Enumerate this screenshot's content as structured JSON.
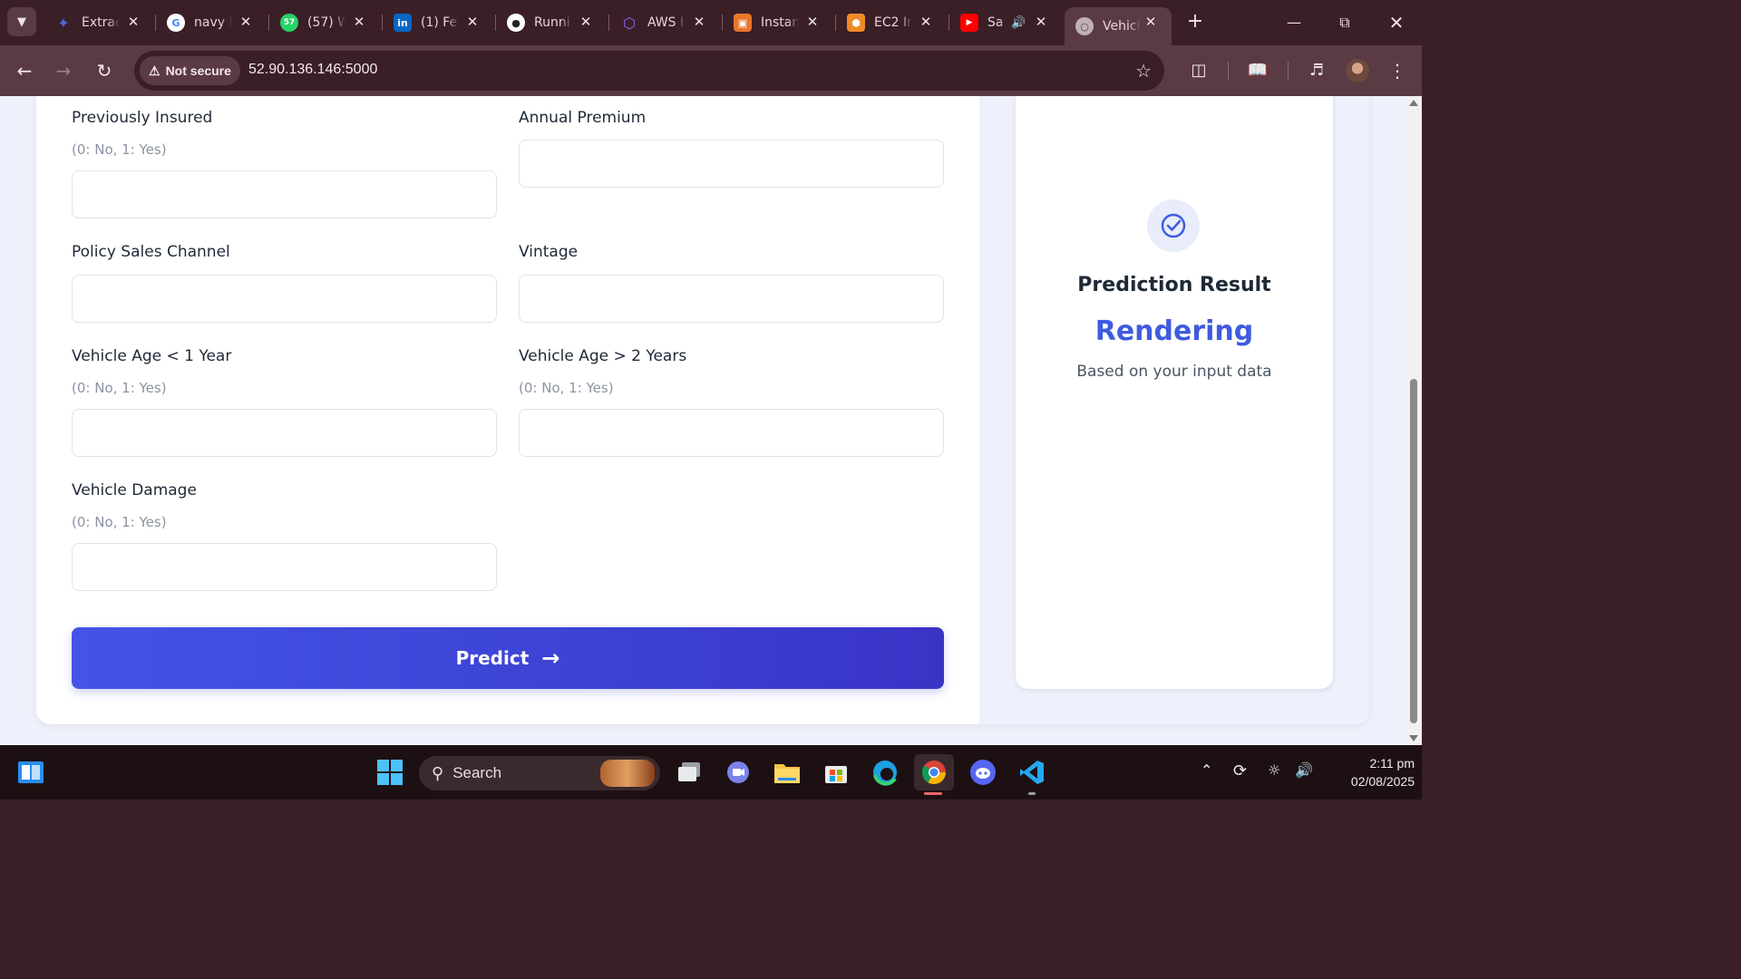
{
  "browser": {
    "tabs": [
      {
        "title": "Extrac",
        "icon": "extract-icon",
        "color": "#4b6cd6"
      },
      {
        "title": "navy l",
        "icon": "google-icon",
        "color": "#ffffff"
      },
      {
        "title": "(57) W",
        "icon": "whatsapp-icon",
        "color": "#25d366",
        "badge": "57"
      },
      {
        "title": "(1) Fe",
        "icon": "linkedin-icon",
        "color": "#0a66c2",
        "badge": "in"
      },
      {
        "title": "Runni",
        "icon": "github-icon",
        "color": "#ffffff"
      },
      {
        "title": "AWS I",
        "icon": "aws-cube-icon",
        "color": "#8c6cf0"
      },
      {
        "title": "Instan",
        "icon": "instance-icon",
        "color": "#e8762b"
      },
      {
        "title": "EC2 Ir",
        "icon": "ec2-icon",
        "color": "#f08a24"
      },
      {
        "title": "Sa",
        "icon": "youtube-icon",
        "color": "#ff0000"
      },
      {
        "title": "Vehicl",
        "icon": "globe-icon",
        "color": "#bfb0b4"
      }
    ],
    "security_label": "Not secure",
    "url": "52.90.136.146:5000"
  },
  "form": {
    "fields": [
      {
        "label": "Previously Insured",
        "hint": "(0: No, 1: Yes)",
        "value": ""
      },
      {
        "label": "Annual Premium",
        "value": ""
      },
      {
        "label": "Policy Sales Channel",
        "value": ""
      },
      {
        "label": "Vintage",
        "value": ""
      },
      {
        "label": "Vehicle Age < 1 Year",
        "hint": "(0: No, 1: Yes)",
        "value": ""
      },
      {
        "label": "Vehicle Age > 2 Years",
        "hint": "(0: No, 1: Yes)",
        "value": ""
      },
      {
        "label": "Vehicle Damage",
        "hint": "(0: No, 1: Yes)",
        "value": ""
      }
    ],
    "submit_label": "Predict"
  },
  "result": {
    "title": "Prediction Result",
    "value": "Rendering",
    "subtitle": "Based on your input data",
    "accent": "#3f5be0"
  },
  "taskbar": {
    "search_label": "Search",
    "time": "2:11 pm",
    "date": "02/08/2025"
  }
}
